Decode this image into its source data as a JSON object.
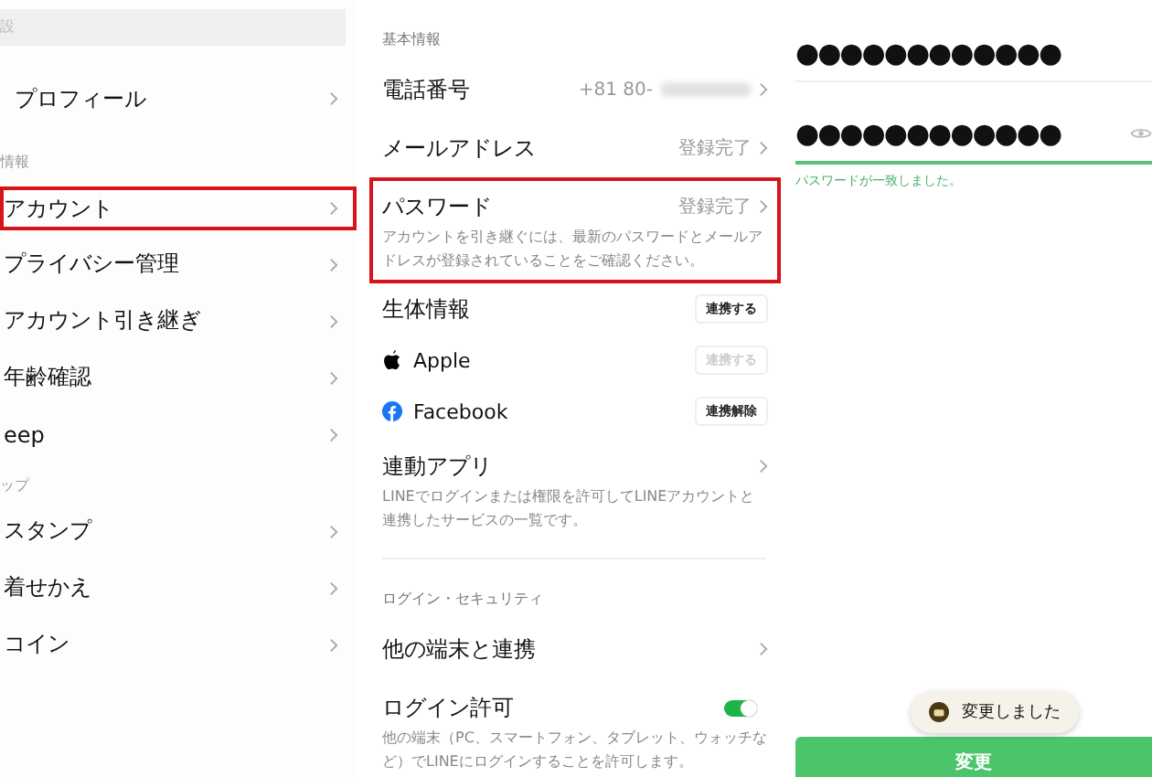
{
  "settings_menu": {
    "search": {
      "placeholder": "設"
    },
    "items": [
      {
        "kind": "profile",
        "label": "プロフィール",
        "highlighted": false
      },
      {
        "kind": "section",
        "label": "情報"
      },
      {
        "kind": "item",
        "label": "アカウント",
        "highlighted": true
      },
      {
        "kind": "item",
        "label": "プライバシー管理",
        "highlighted": false
      },
      {
        "kind": "item",
        "label": "アカウント引き継ぎ",
        "highlighted": false
      },
      {
        "kind": "item",
        "label": "年齢確認",
        "highlighted": false
      },
      {
        "kind": "item",
        "label": "eep",
        "highlighted": false
      },
      {
        "kind": "section",
        "label": "ップ"
      },
      {
        "kind": "item",
        "label": "スタンプ",
        "highlighted": false
      },
      {
        "kind": "item",
        "label": "着せかえ",
        "highlighted": false
      },
      {
        "kind": "item",
        "label": "コイン",
        "highlighted": false
      }
    ]
  },
  "account_panel": {
    "rows": [
      {
        "kind": "section",
        "label": "基本情報"
      },
      {
        "kind": "link",
        "label": "電話番号",
        "value": "+81 80-",
        "redacted": true,
        "highlighted": false
      },
      {
        "kind": "link",
        "label": "メールアドレス",
        "value": "登録完了",
        "redacted": false,
        "highlighted": false
      },
      {
        "kind": "link",
        "label": "パスワード",
        "value": "登録完了",
        "redacted": false,
        "highlighted": true,
        "description": "アカウントを引き継ぐには、最新のパスワードとメールアドレスが登録されていることをご確認ください。"
      },
      {
        "kind": "button",
        "label": "生体情報",
        "button": {
          "label": "連携する",
          "disabled": false
        }
      },
      {
        "kind": "apple",
        "label": "Apple",
        "button": {
          "label": "連携する",
          "disabled": true
        }
      },
      {
        "kind": "facebook",
        "label": "Facebook",
        "button": {
          "label": "連携解除",
          "disabled": false
        }
      },
      {
        "kind": "link",
        "label": "連動アプリ",
        "redacted": false,
        "highlighted": false,
        "description": "LINEでログインまたは権限を許可してLINEアカウントと連携したサービスの一覧です。"
      },
      {
        "kind": "divider"
      },
      {
        "kind": "section",
        "label": "ログイン・セキュリティ"
      },
      {
        "kind": "link",
        "label": "他の端末と連携",
        "redacted": false,
        "highlighted": false
      },
      {
        "kind": "toggle",
        "label": "ログイン許可",
        "on": true,
        "description": "他の端末（PC、スマートフォン、タブレット、ウォッチなど）でLINEにログインすることを許可します。"
      }
    ]
  },
  "password_form": {
    "fields": [
      {
        "value": "●●●●●●●●●●●●",
        "reveal_icon": false,
        "matched": false
      },
      {
        "value": "●●●●●●●●●●●●",
        "reveal_icon": true,
        "matched": true
      }
    ],
    "match_message": "パスワードが一致しました。",
    "toast": "変更しました",
    "submit": "変更"
  }
}
